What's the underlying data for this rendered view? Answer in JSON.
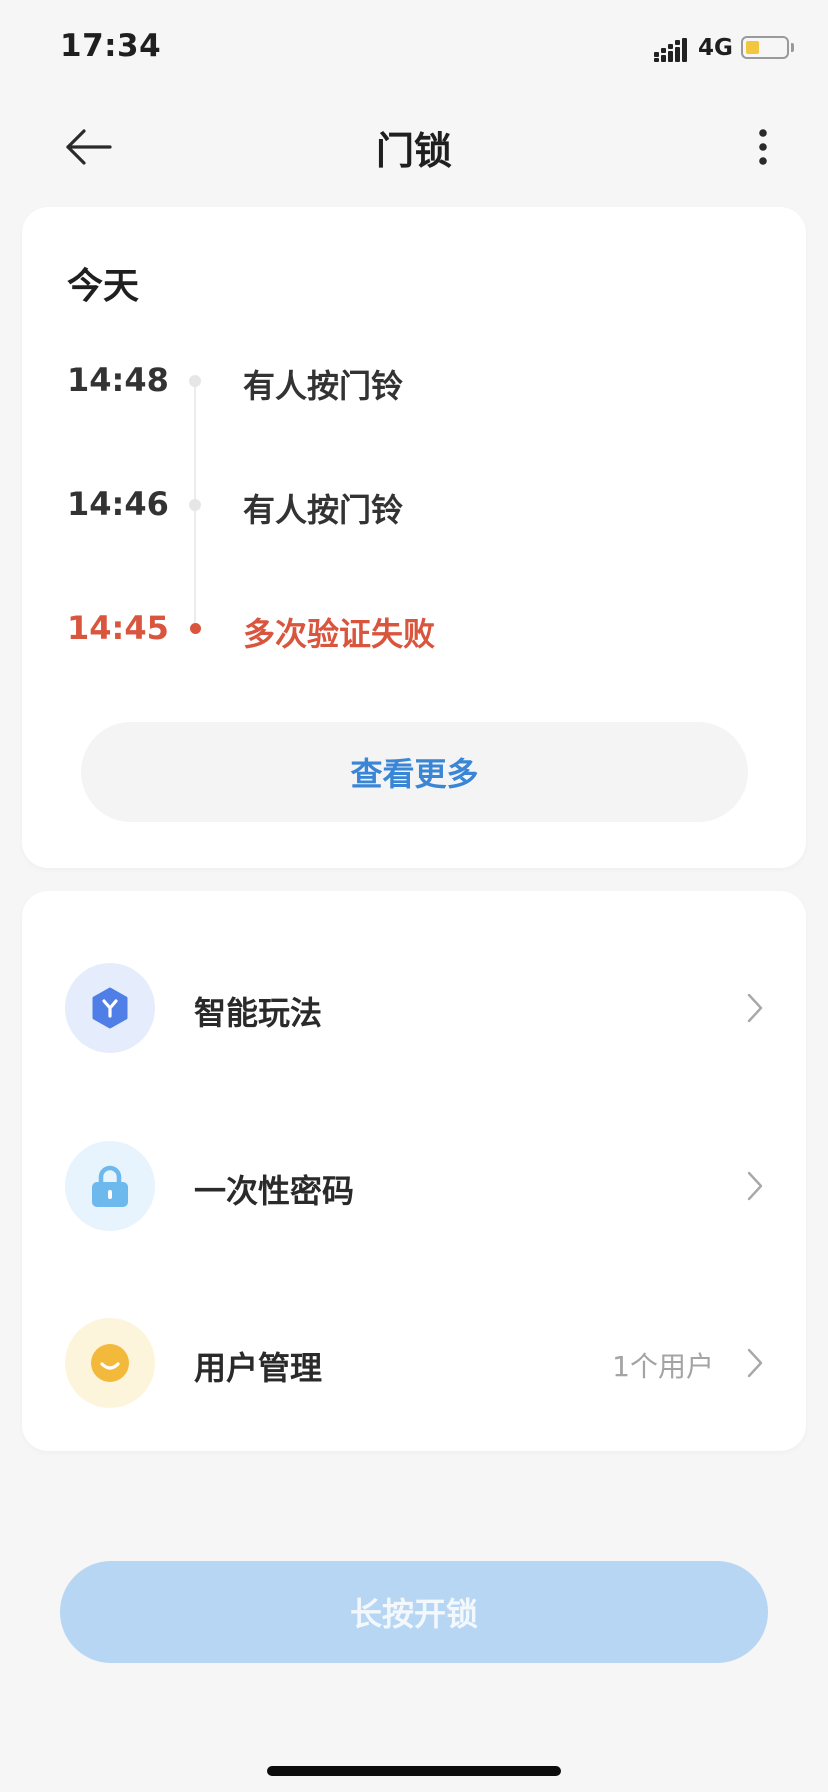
{
  "status_bar": {
    "time": "17:34",
    "network": "4G",
    "battery_level": 0.35
  },
  "header": {
    "title": "门锁"
  },
  "activity": {
    "section_title": "今天",
    "events": [
      {
        "time": "14:48",
        "text": "有人按门铃",
        "alert": false
      },
      {
        "time": "14:46",
        "text": "有人按门铃",
        "alert": false
      },
      {
        "time": "14:45",
        "text": "多次验证失败",
        "alert": true
      }
    ],
    "more_label": "查看更多"
  },
  "menu": {
    "items": [
      {
        "label": "智能玩法",
        "value": "",
        "icon": "smart-scene-icon",
        "icon_bg": "#e5ecfb",
        "icon_color": "#4f7fe6"
      },
      {
        "label": "一次性密码",
        "value": "",
        "icon": "lock-icon",
        "icon_bg": "#e7f3fd",
        "icon_color": "#6db9ee"
      },
      {
        "label": "用户管理",
        "value": "1个用户",
        "icon": "user-face-icon",
        "icon_bg": "#fdf4dc",
        "icon_color": "#f3b93a"
      }
    ]
  },
  "actions": {
    "unlock_label": "长按开锁"
  },
  "colors": {
    "accent": "#3a86d6",
    "alert": "#d9553d",
    "unlock_button": "#b7d6f3"
  }
}
